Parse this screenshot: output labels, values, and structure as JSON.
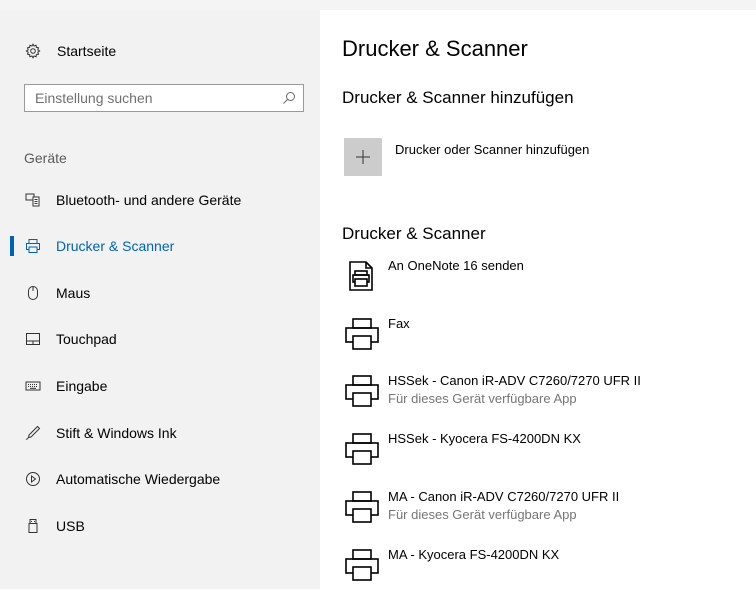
{
  "sidebar": {
    "home_label": "Startseite",
    "search_placeholder": "Einstellung suchen",
    "section_label": "Geräte",
    "items": [
      {
        "label": "Bluetooth- und andere Geräte",
        "icon": "bluetooth-devices-icon"
      },
      {
        "label": "Drucker & Scanner",
        "icon": "printer-icon",
        "active": true
      },
      {
        "label": "Maus",
        "icon": "mouse-icon"
      },
      {
        "label": "Touchpad",
        "icon": "touchpad-icon"
      },
      {
        "label": "Eingabe",
        "icon": "keyboard-icon"
      },
      {
        "label": "Stift & Windows Ink",
        "icon": "pen-icon"
      },
      {
        "label": "Automatische Wiedergabe",
        "icon": "autoplay-icon"
      },
      {
        "label": "USB",
        "icon": "usb-icon"
      }
    ]
  },
  "main": {
    "title": "Drucker & Scanner",
    "add_heading": "Drucker & Scanner hinzufügen",
    "add_label": "Drucker oder Scanner hinzufügen",
    "list_heading": "Drucker & Scanner",
    "printers": [
      {
        "name": "An OneNote 16 senden",
        "subtitle": "",
        "icon": "onenote-printer-icon"
      },
      {
        "name": "Fax",
        "subtitle": "",
        "icon": "printer-icon"
      },
      {
        "name": "HSSek - Canon iR-ADV C7260/7270 UFR II",
        "subtitle": "Für dieses Gerät verfügbare App",
        "icon": "printer-icon"
      },
      {
        "name": "HSSek - Kyocera FS-4200DN KX",
        "subtitle": "",
        "icon": "printer-icon"
      },
      {
        "name": "MA - Canon iR-ADV C7260/7270 UFR II",
        "subtitle": "Für dieses Gerät verfügbare App",
        "icon": "printer-icon"
      },
      {
        "name": "MA - Kyocera FS-4200DN KX",
        "subtitle": "",
        "icon": "printer-icon"
      }
    ]
  },
  "colors": {
    "accent": "#0063b1",
    "sidebar_bg": "#f2f2f2",
    "tile_bg": "#cccccc"
  }
}
